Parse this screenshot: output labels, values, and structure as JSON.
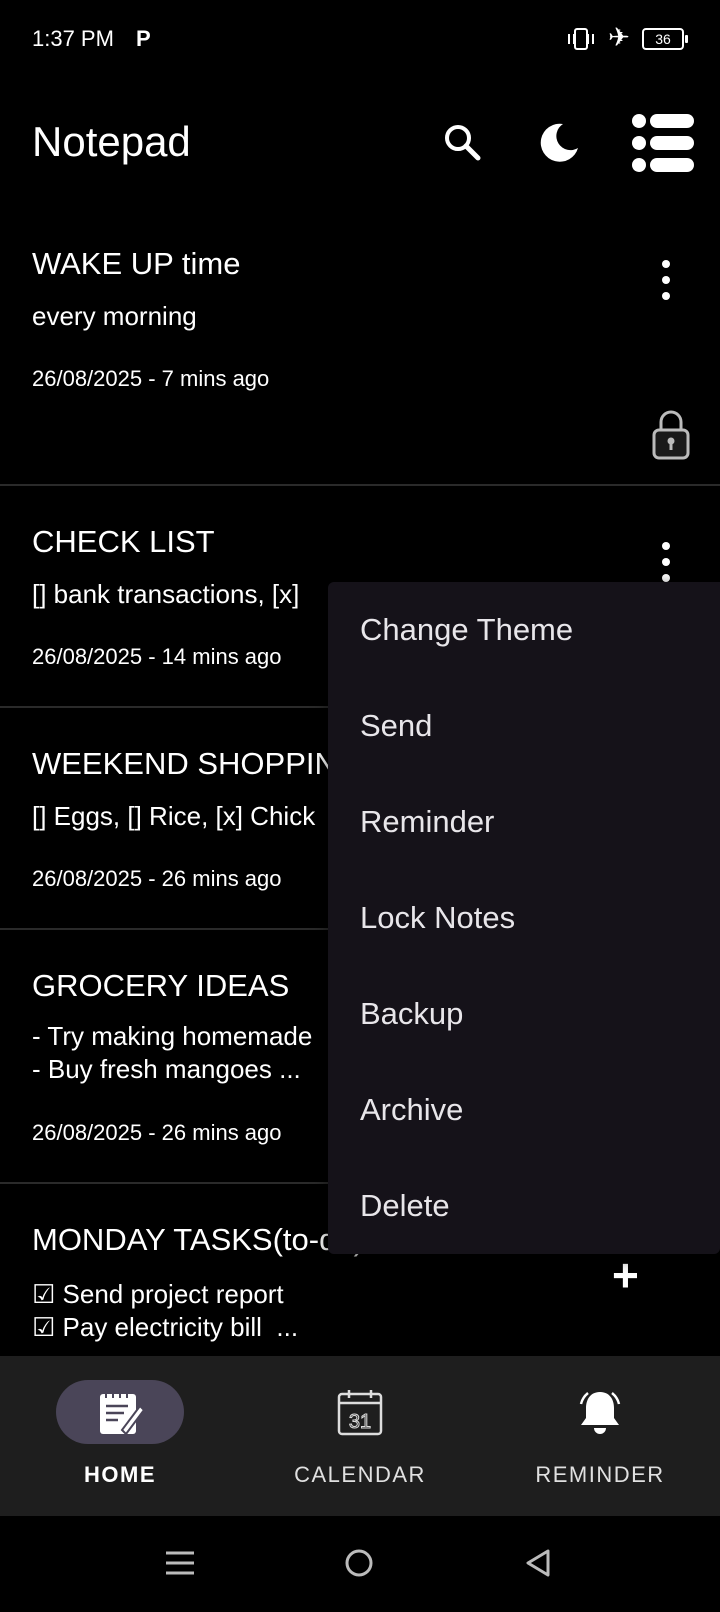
{
  "status_bar": {
    "time": "1:37 PM",
    "p_icon": "P",
    "battery": "36",
    "icons": [
      "vibrate-icon",
      "airplane-icon",
      "battery-icon"
    ]
  },
  "header": {
    "title": "Notepad",
    "icons": [
      "search-icon",
      "moon-icon",
      "list-view-icon"
    ]
  },
  "notes": [
    {
      "title": "WAKE UP time",
      "body": "every morning",
      "date": "26/08/2025 - 7 mins ago",
      "locked": true
    },
    {
      "title": "CHECK LIST",
      "body": "[] bank transactions, [x]",
      "date": "26/08/2025 - 14 mins ago"
    },
    {
      "title": "WEEKEND SHOPPING",
      "body": "[] Eggs, [] Rice, [x] Chick",
      "date": "26/08/2025 - 26 mins ago"
    },
    {
      "title": "GROCERY IDEAS",
      "body": "- Try making homemade\n- Buy fresh mangoes ...",
      "date": "26/08/2025 - 26 mins ago"
    },
    {
      "title": "MONDAY TASKS(to-do)",
      "body": "☑ Send project report\n☑ Pay electricity bill  ..."
    }
  ],
  "context_menu": {
    "items": [
      "Change Theme",
      "Send",
      "Reminder",
      "Lock Notes",
      "Backup",
      "Archive",
      "Delete"
    ]
  },
  "bottom_nav": {
    "items": [
      {
        "label": "HOME",
        "active": true,
        "icon": "notepad-icon"
      },
      {
        "label": "CALENDAR",
        "icon": "calendar-icon",
        "day": "31"
      },
      {
        "label": "REMINDER",
        "icon": "bell-icon"
      }
    ]
  },
  "system_nav": [
    "menu-icon",
    "home-circle-icon",
    "back-triangle-icon"
  ],
  "colors": {
    "background": "#000000",
    "menu_bg": "#151219",
    "nav_bg": "#1e1e1e",
    "active_pill": "#4a4558"
  }
}
